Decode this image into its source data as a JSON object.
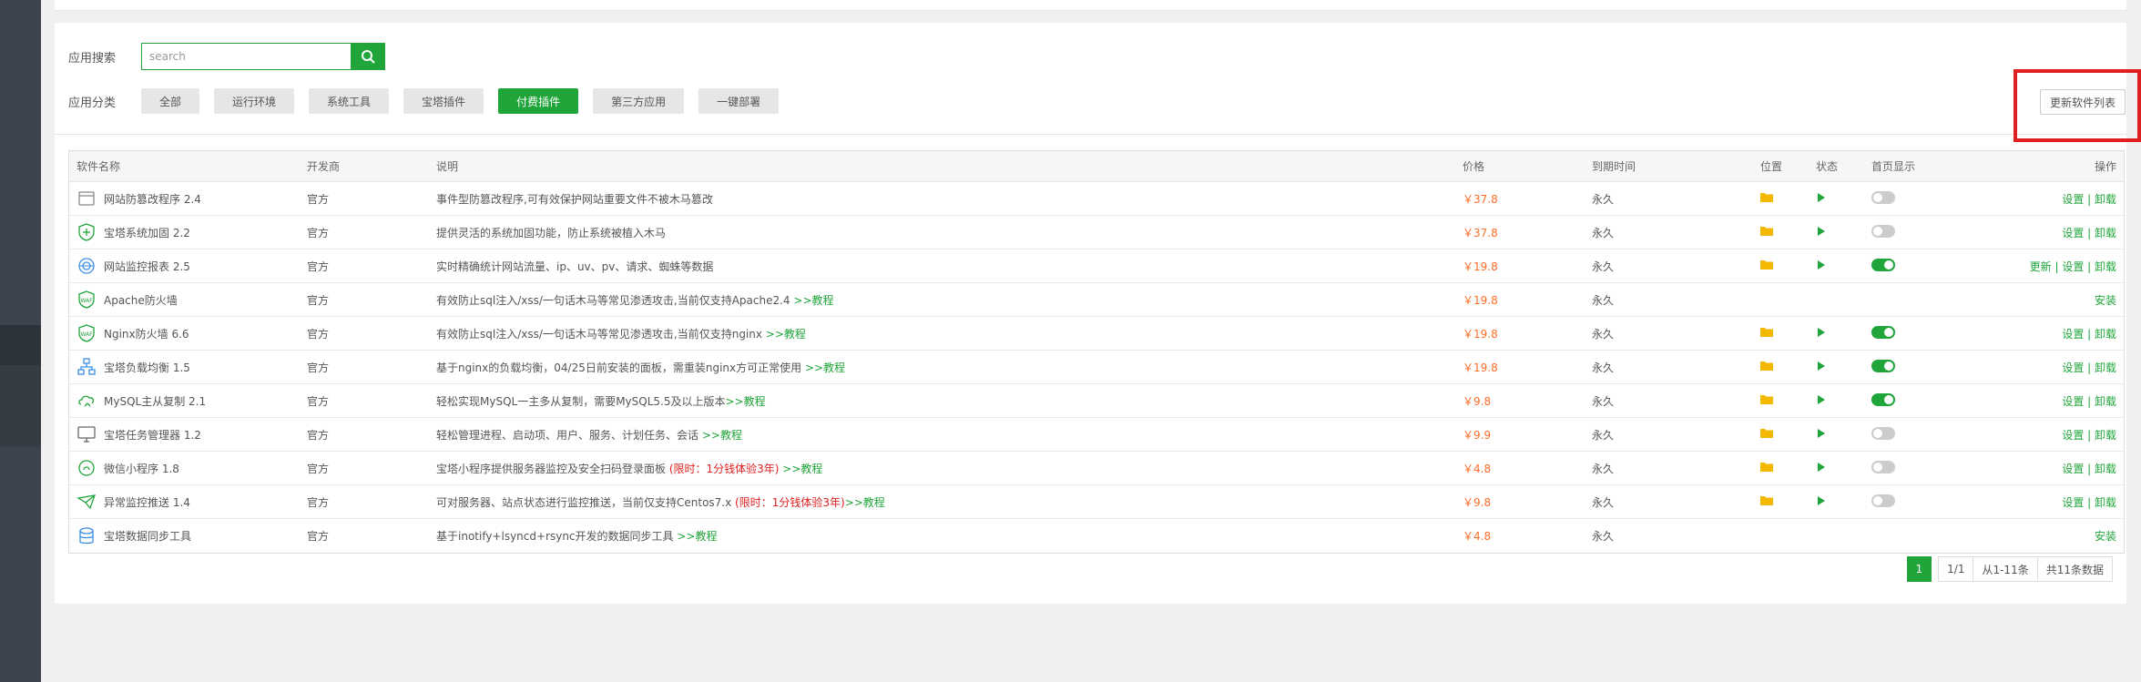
{
  "search": {
    "label": "应用搜索",
    "placeholder": "search"
  },
  "categories": {
    "label": "应用分类",
    "items": [
      "全部",
      "运行环境",
      "系统工具",
      "宝塔插件",
      "付费插件",
      "第三方应用",
      "一键部署"
    ],
    "active": "付费插件"
  },
  "update_button": "更新软件列表",
  "table": {
    "headers": [
      "软件名称",
      "开发商",
      "说明",
      "价格",
      "到期时间",
      "位置",
      "状态",
      "首页显示",
      "操作"
    ],
    "rows": [
      {
        "name": "网站防篡改程序 2.4",
        "icon": "anti-tamper-icon",
        "dev": "官方",
        "desc": "事件型防篡改程序,可有效保护网站重要文件不被木马篡改",
        "tut": "",
        "price": "￥37.8",
        "exp": "永久",
        "op": "设置 | 卸载"
      },
      {
        "name": "宝塔系统加固 2.2",
        "icon": "shield-icon",
        "dev": "官方",
        "desc": "提供灵活的系统加固功能，防止系统被植入木马",
        "tut": "",
        "price": "￥37.8",
        "exp": "永久",
        "op": "设置 | 卸载"
      },
      {
        "name": "网站监控报表 2.5",
        "icon": "monitor-report-icon",
        "dev": "官方",
        "desc": "实时精确统计网站流量、ip、uv、pv、请求、蜘蛛等数据",
        "tut": "",
        "price": "￥19.8",
        "exp": "永久",
        "op": "更新 | 设置 | 卸载"
      },
      {
        "name": "Apache防火墙",
        "icon": "waf-icon",
        "dev": "官方",
        "desc": "有效防止sql注入/xss/一句话木马等常见渗透攻击,当前仅支持Apache2.4 ",
        "tut": ">>教程",
        "price": "￥19.8",
        "exp": "永久",
        "op": "安装"
      },
      {
        "name": "Nginx防火墙 6.6",
        "icon": "waf-icon",
        "dev": "官方",
        "desc": "有效防止sql注入/xss/一句话木马等常见渗透攻击,当前仅支持nginx ",
        "tut": ">>教程",
        "price": "￥19.8",
        "exp": "永久",
        "op": "设置 | 卸载"
      },
      {
        "name": "宝塔负载均衡 1.5",
        "icon": "load-balance-icon",
        "dev": "官方",
        "desc": "基于nginx的负载均衡，04/25日前安装的面板，需重装nginx方可正常使用 ",
        "tut": ">>教程",
        "price": "￥19.8",
        "exp": "永久",
        "op": "设置 | 卸载"
      },
      {
        "name": "MySQL主从复制 2.1",
        "icon": "cloud-sync-icon",
        "dev": "官方",
        "desc": "轻松实现MySQL一主多从复制，需要MySQL5.5及以上版本",
        "tut": ">>教程",
        "price": "￥9.8",
        "exp": "永久",
        "op": "设置 | 卸载"
      },
      {
        "name": "宝塔任务管理器 1.2",
        "icon": "task-manager-icon",
        "dev": "官方",
        "desc": "轻松管理进程、启动项、用户、服务、计划任务、会话 ",
        "tut": ">>教程",
        "price": "￥9.9",
        "exp": "永久",
        "op": "设置 | 卸载"
      },
      {
        "name": "微信小程序 1.8",
        "icon": "wechat-app-icon",
        "dev": "官方",
        "desc": "宝塔小程序提供服务器监控及安全扫码登录面板 ",
        "red": "(限时：1分钱体验3年)",
        "tut": " >>教程",
        "price": "￥4.8",
        "exp": "永久",
        "op": "设置 | 卸载"
      },
      {
        "name": "异常监控推送 1.4",
        "icon": "alert-push-icon",
        "dev": "官方",
        "desc": "可对服务器、站点状态进行监控推送，当前仅支持Centos7.x ",
        "red": "(限时：1分钱体验3年)",
        "tut": ">>教程",
        "price": "￥9.8",
        "exp": "永久",
        "op": "设置 | 卸载"
      },
      {
        "name": "宝塔数据同步工具",
        "icon": "data-sync-icon",
        "dev": "官方",
        "desc": "基于inotify+lsyncd+rsync开发的数据同步工具 ",
        "tut": ">>教程",
        "price": "￥4.8",
        "exp": "永久",
        "op": "安装"
      }
    ]
  },
  "pager": {
    "current": "1",
    "pages": "1/1",
    "range": "从1-11条",
    "total": "共11条数据"
  }
}
